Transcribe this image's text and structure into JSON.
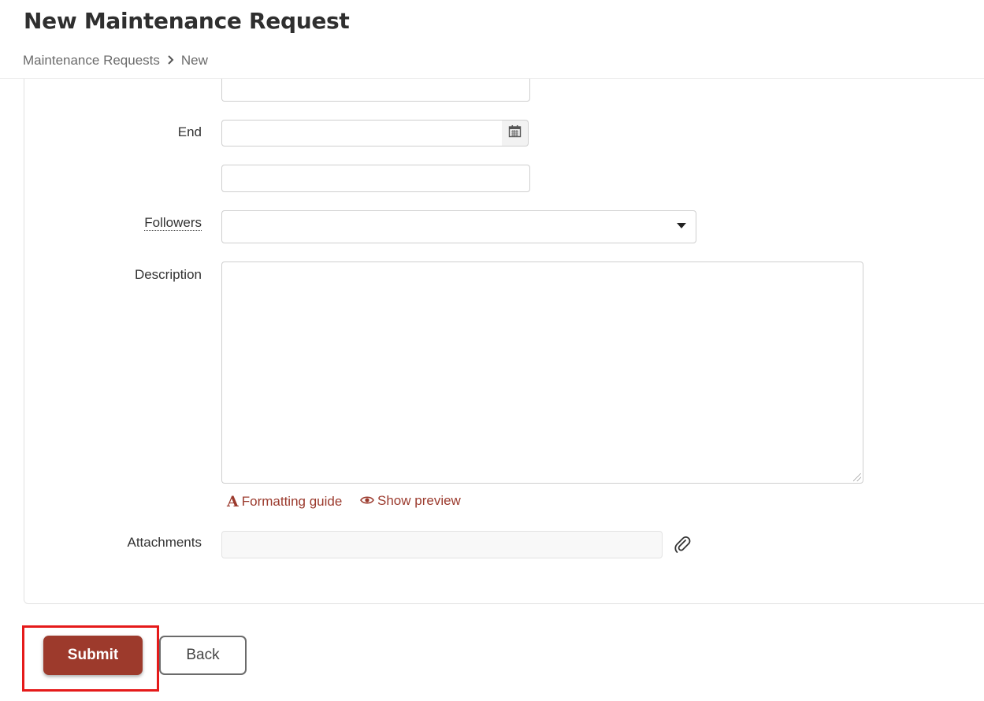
{
  "page": {
    "title": "New Maintenance Request"
  },
  "breadcrumb": {
    "items": [
      "Maintenance Requests",
      "New"
    ],
    "separator": "›"
  },
  "form": {
    "end_label": "End",
    "end_date_value": "",
    "end_time_value": "",
    "followers_label": "Followers",
    "followers_value": "",
    "description_label": "Description",
    "description_value": "",
    "formatting_guide_label": "Formatting guide",
    "show_preview_label": "Show preview",
    "attachments_label": "Attachments",
    "icons": {
      "calendar": "calendar-icon",
      "dropdown": "chevron-down-icon",
      "formatting": "text-format-icon",
      "preview": "eye-icon",
      "attachment": "paperclip-icon"
    }
  },
  "actions": {
    "submit_label": "Submit",
    "back_label": "Back"
  },
  "colors": {
    "accent": "#9d3a2c",
    "highlight": "#e51a1a"
  }
}
